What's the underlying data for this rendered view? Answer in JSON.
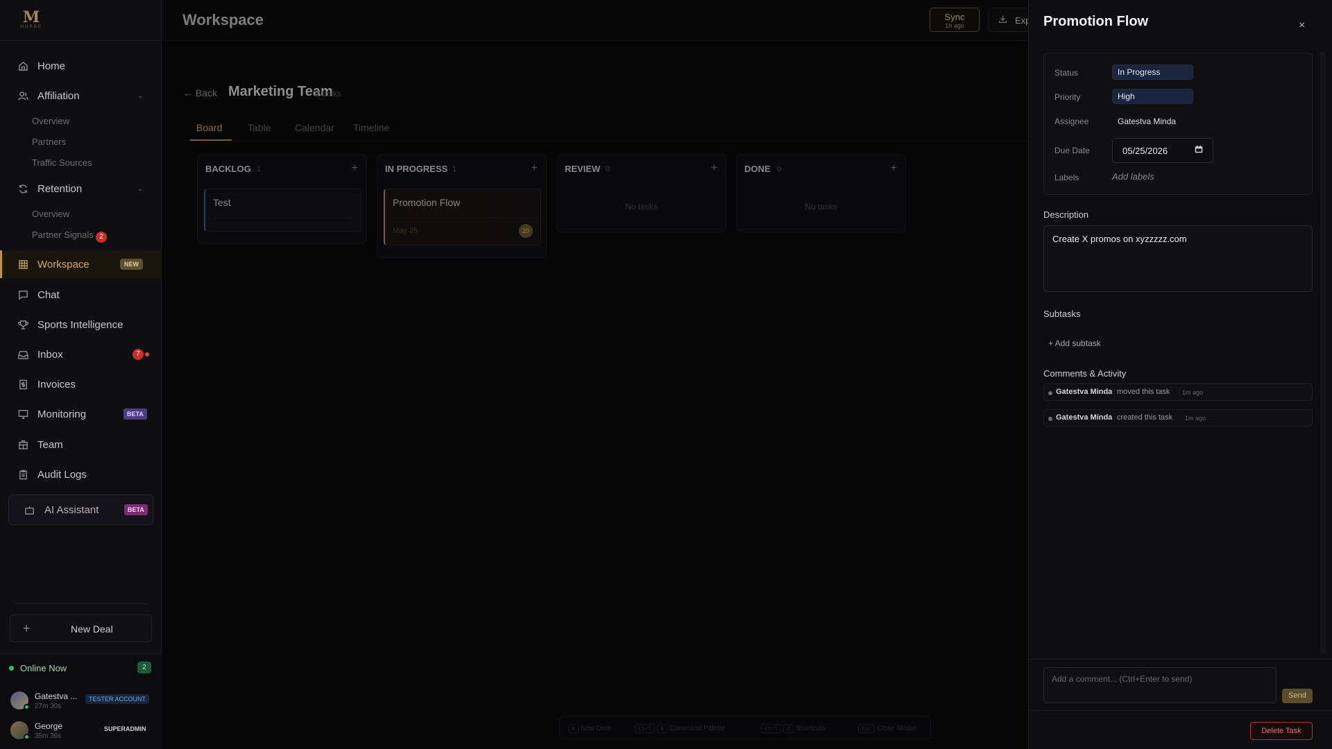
{
  "brand": {
    "logo_mark": "M",
    "logo_word": "MURBE"
  },
  "sidebar": {
    "items": [
      {
        "label": "Home",
        "icon": "home-icon"
      },
      {
        "label": "Affiliation",
        "icon": "users-icon",
        "sub": [
          "Overview",
          "Partners",
          "Traffic Sources"
        ]
      },
      {
        "label": "Retention",
        "icon": "refresh-icon",
        "sub": [
          "Overview",
          "Partner Signals"
        ],
        "sub_badge": "2"
      },
      {
        "label": "Workspace",
        "icon": "grid-icon",
        "badge": "NEW"
      },
      {
        "label": "Chat",
        "icon": "chat-icon"
      },
      {
        "label": "Sports Intelligence",
        "icon": "trophy-icon"
      },
      {
        "label": "Inbox",
        "icon": "inbox-icon",
        "count": "7"
      },
      {
        "label": "Invoices",
        "icon": "invoice-icon"
      },
      {
        "label": "Monitoring",
        "icon": "monitor-icon",
        "badge": "BETA"
      },
      {
        "label": "Team",
        "icon": "team-icon"
      },
      {
        "label": "Audit Logs",
        "icon": "clipboard-icon"
      }
    ],
    "ai": {
      "label": "AI Assistant",
      "badge": "BETA"
    },
    "new_deal": "New Deal",
    "online": {
      "label": "Online Now",
      "count": "2"
    },
    "users": [
      {
        "name": "Gatestva ...",
        "time": "27m 30s",
        "tag": "TESTER ACCOUNT"
      },
      {
        "name": "George",
        "time": "35m 36s",
        "tag": "SUPERADMIN"
      }
    ]
  },
  "header": {
    "title": "Workspace",
    "sync_label": "Sync",
    "sync_sub": "1h ago",
    "export_label": "Exp"
  },
  "board": {
    "back": "← Back",
    "title": "Marketing Team",
    "count": "2 tasks",
    "tabs": [
      "Board",
      "Table",
      "Calendar",
      "Timeline"
    ],
    "columns": [
      {
        "name": "BACKLOG",
        "count": "1",
        "cards": [
          {
            "title": "Test"
          }
        ]
      },
      {
        "name": "IN PROGRESS",
        "count": "1",
        "cards": [
          {
            "title": "Promotion Flow",
            "date": "May 25",
            "avatar": "20"
          }
        ]
      },
      {
        "name": "REVIEW",
        "count": "0",
        "empty": "No tasks"
      },
      {
        "name": "DONE",
        "count": "0",
        "empty": "No tasks"
      }
    ],
    "shortcuts": [
      {
        "keys": [
          "N"
        ],
        "label": "New Deal"
      },
      {
        "keys": [
          "Ctrl",
          "K"
        ],
        "label": "Command Palette"
      },
      {
        "keys": [
          "Ctrl",
          "/"
        ],
        "label": "Shortcuts"
      },
      {
        "keys": [
          "Esc"
        ],
        "label": "Close Modal"
      }
    ]
  },
  "drawer": {
    "title": "Promotion Flow",
    "close": "×",
    "status_label": "Status",
    "status": "In Progress",
    "priority_label": "Priority",
    "priority": "High",
    "assignee_label": "Assignee",
    "assignee": "Gatestva Minda",
    "due_label": "Due Date",
    "due": "05/25/2026",
    "labels_label": "Labels",
    "labels_placeholder": "Add labels",
    "description_label": "Description",
    "description": "Create X promos on xyzzzzz.com",
    "subtasks_label": "Subtasks",
    "add_subtask": "+ Add subtask",
    "activity_label": "Comments & Activity",
    "activity": [
      {
        "name": "Gatestva Minda",
        "action": "moved this task",
        "time": "1m ago"
      },
      {
        "name": "Gatestva Minda",
        "action": "created this task",
        "time": "1m ago"
      }
    ],
    "comment_placeholder": "Add a comment... (Ctrl+Enter to send)",
    "send": "Send",
    "delete": "Delete Task"
  }
}
